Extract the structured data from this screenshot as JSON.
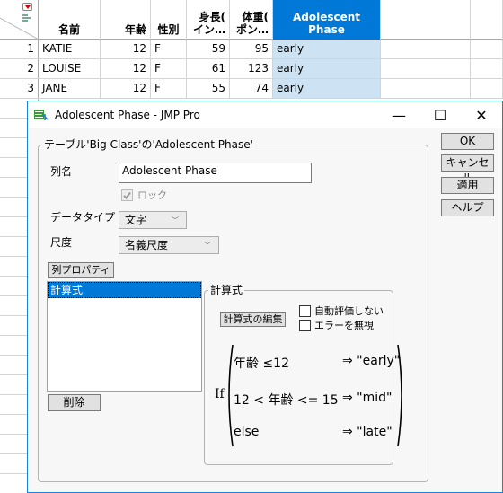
{
  "table": {
    "columns": [
      {
        "label": "名前",
        "align": "left"
      },
      {
        "label": "年齢",
        "align": "right"
      },
      {
        "label": "性別",
        "align": "left"
      },
      {
        "label_line1": "身長(",
        "label_line2": "イン…",
        "align": "right"
      },
      {
        "label_line1": "体重(",
        "label_line2": "ポン…",
        "align": "right"
      },
      {
        "label": "Adolescent Phase",
        "align": "left",
        "selected": true
      }
    ],
    "rows": [
      {
        "num": "1",
        "name": "KATIE",
        "age": "12",
        "sex": "F",
        "height": "59",
        "weight": "95",
        "phase": "early"
      },
      {
        "num": "2",
        "name": "LOUISE",
        "age": "12",
        "sex": "F",
        "height": "61",
        "weight": "123",
        "phase": "early"
      },
      {
        "num": "3",
        "name": "JANE",
        "age": "12",
        "sex": "F",
        "height": "55",
        "weight": "74",
        "phase": "early"
      }
    ],
    "hidden_row_numbers": [
      "1",
      "1",
      "1",
      "1",
      "1",
      "1",
      "1",
      "1",
      "1",
      "1",
      "2",
      "2",
      "2",
      "2"
    ],
    "selected_color": "#0078d7",
    "selected_cell_color": "#cde3f4"
  },
  "dialog": {
    "title": "Adolescent Phase - JMP Pro",
    "window_controls": {
      "minimize": "—",
      "maximize": "☐",
      "close": "✕"
    },
    "group_label": "テーブル'Big Class'の'Adolescent Phase'",
    "column_name_label": "列名",
    "column_name_value": "Adolescent Phase",
    "lock_label": "ロック",
    "lock_checked": true,
    "data_type_label": "データタイプ",
    "data_type_value": "文字",
    "modeling_type_label": "尺度",
    "modeling_type_value": "名義尺度",
    "column_properties_button": "列プロパティ ▾",
    "properties_list": [
      "計算式"
    ],
    "delete_button": "削除",
    "buttons": {
      "ok": "OK",
      "cancel": "キャンセル",
      "apply": "適用",
      "help": "ヘルプ"
    },
    "formula_group": {
      "label": "計算式",
      "edit_button": "計算式の編集",
      "suppress_eval_label": "自動評価しない",
      "suppress_eval_checked": false,
      "ignore_errors_label": "エラーを無視",
      "ignore_errors_checked": false,
      "if_keyword": "If",
      "clauses": [
        {
          "condition": "年齢 ≤12",
          "result": "⇒ \"early\""
        },
        {
          "condition": "12 < 年齢 <= 15",
          "result": "⇒ \"mid\""
        },
        {
          "condition": "else",
          "result": "⇒ \"late\""
        }
      ]
    }
  }
}
